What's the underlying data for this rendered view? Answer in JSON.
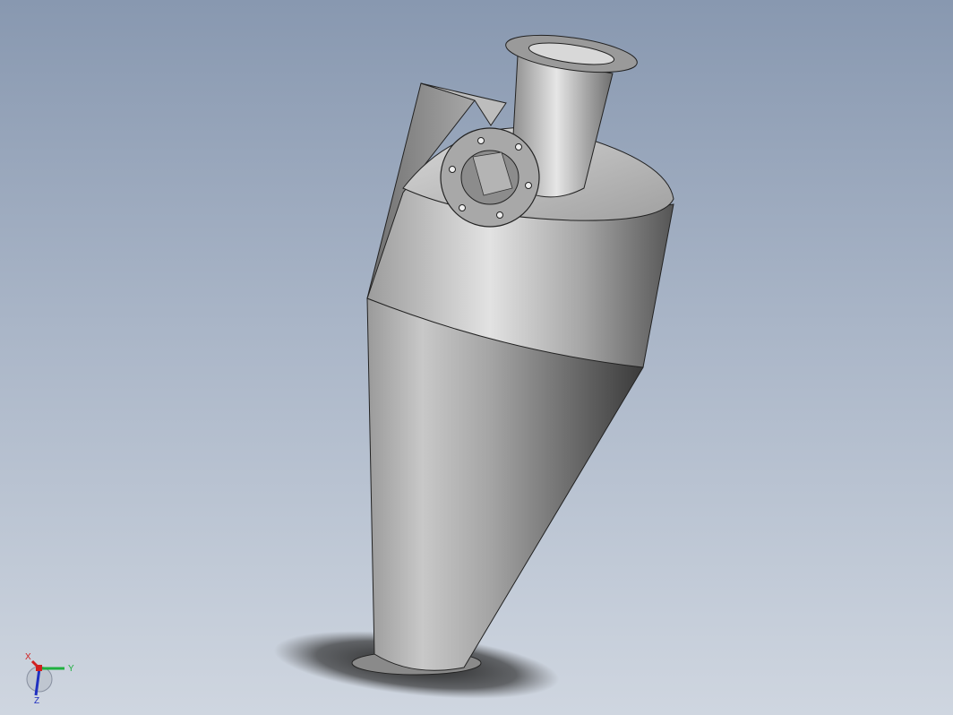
{
  "viewport": {
    "background_top": "#8898b0",
    "background_bottom": "#cfd6e0"
  },
  "model": {
    "type": "cyclone separator",
    "body_color": "#b8b8b8",
    "edge_color": "#222222"
  },
  "triad": {
    "x_label": "X",
    "y_label": "Y",
    "z_label": "Z",
    "x_color": "#d02020",
    "y_color": "#20b040",
    "z_color": "#2030c0"
  }
}
